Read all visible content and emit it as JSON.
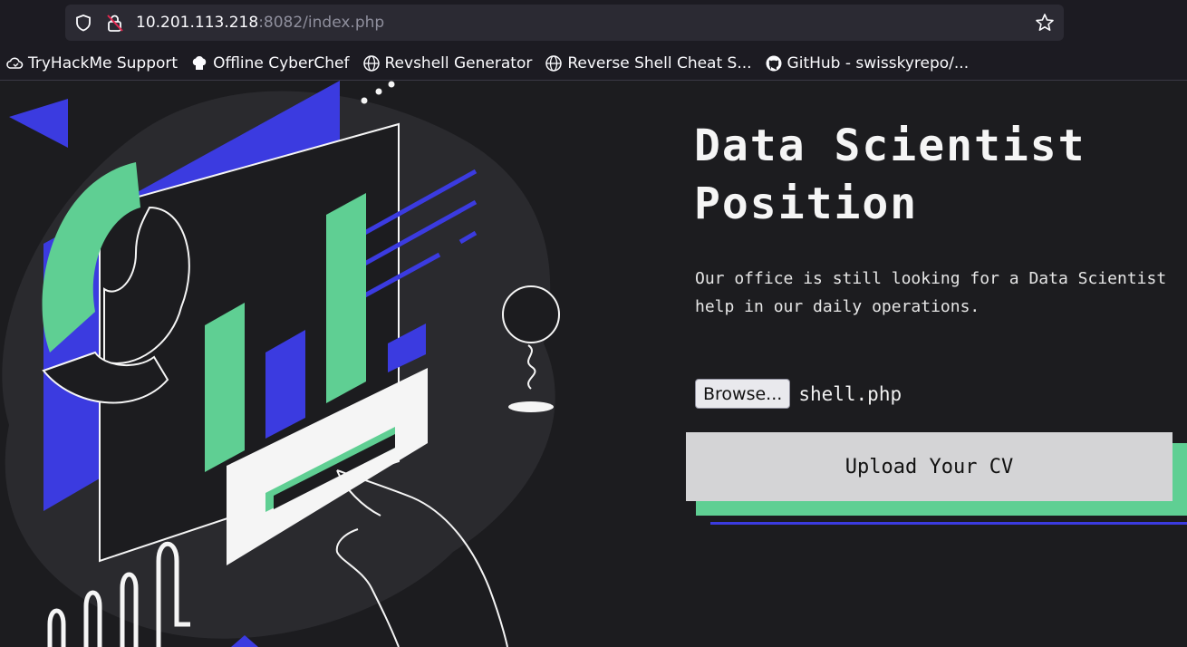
{
  "browser": {
    "url_host": "10.201.113.218",
    "url_rest": ":8082/index.php",
    "bookmarks": [
      {
        "label": "TryHackMe Support",
        "icon": "cloud-icon"
      },
      {
        "label": "Offline CyberChef",
        "icon": "chef-hat-icon"
      },
      {
        "label": "Revshell Generator",
        "icon": "globe-icon"
      },
      {
        "label": "Reverse Shell Cheat S...",
        "icon": "globe-icon"
      },
      {
        "label": "GitHub - swisskyrepo/...",
        "icon": "github-icon"
      }
    ]
  },
  "page": {
    "title_line1": "Data Scientist",
    "title_line2": "Position",
    "description_line1": "Our office is still looking for a Data Scientist",
    "description_line2": "help in our daily operations.",
    "browse_label": "Browse...",
    "file_name": "shell.php",
    "upload_label": "Upload Your CV"
  },
  "colors": {
    "background": "#1c1c1f",
    "accent_blue": "#3b3be0",
    "accent_green": "#5fcf93",
    "button_gray": "#d4d4d6"
  }
}
